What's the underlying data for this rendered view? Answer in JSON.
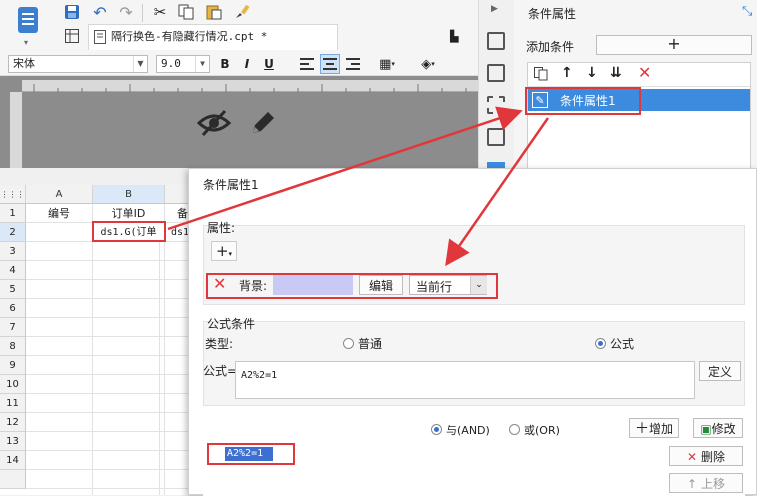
{
  "toolbar": {
    "file_tab": "隔行换色-有隐藏行情况.cpt *"
  },
  "format_bar": {
    "font_name": "宋体",
    "font_size": "9.0",
    "bold": "B",
    "italic": "I",
    "underline": "U"
  },
  "sheet": {
    "columns": [
      "A",
      "B"
    ],
    "rows": [
      "1",
      "2",
      "3",
      "4",
      "5",
      "6",
      "7",
      "8",
      "9",
      "10",
      "11",
      "12",
      "13",
      "14"
    ],
    "cells": {
      "a1": "编号",
      "b1": "订单ID",
      "c1": "备",
      "b2": "ds1.G(订单",
      "c2": "ds1"
    }
  },
  "right_panel": {
    "title": "条件属性",
    "add_condition_label": "添加条件",
    "selected_item": "条件属性1"
  },
  "dialog": {
    "title": "条件属性1",
    "properties_label": "属性:",
    "background_label": "背景:",
    "background_color": "#c9c9f5",
    "edit_button": "编辑",
    "scope_value": "当前行",
    "formula_condition_title": "公式条件",
    "type_label": "类型:",
    "type_normal": "普通",
    "type_formula": "公式",
    "formula_label": "公式=",
    "formula_value": "A2%2=1",
    "define_button": "定义",
    "and_label": "与(AND)",
    "or_label": "或(OR)",
    "add_button": "增加",
    "modify_button": "修改",
    "delete_button": "删除",
    "move_up_button": "上移",
    "condition_item": "A2%2=1"
  },
  "colors": {
    "accent_blue": "#2f7fd3",
    "highlight_red": "#e0373c",
    "selected_row": "#3d8bde"
  }
}
